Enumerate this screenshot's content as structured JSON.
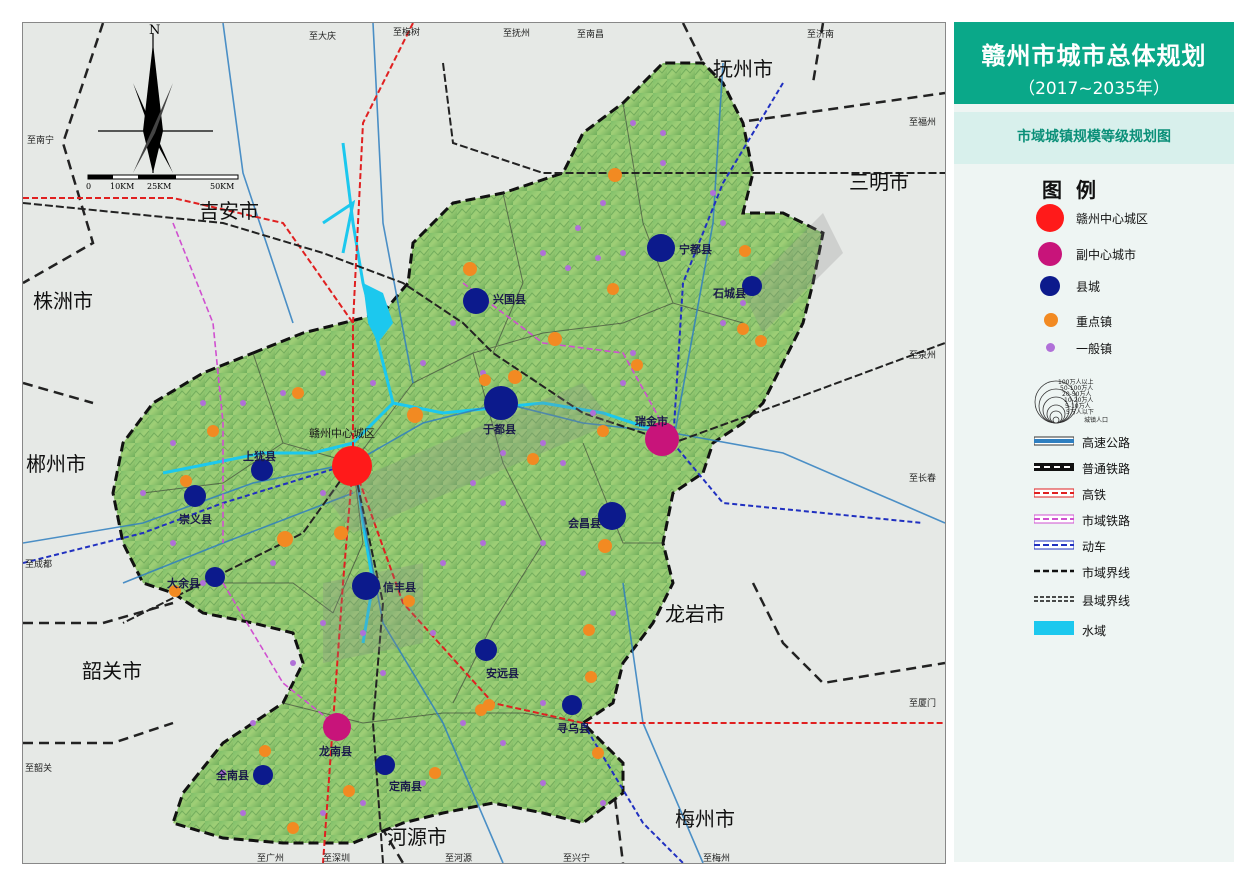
{
  "panel": {
    "title": "赣州市城市总体规划",
    "years": "（2017~2035年）",
    "subtitle": "市域城镇规模等级规划图",
    "legend_heading": "图例",
    "legend": {
      "center": "赣州中心城区",
      "sub_center": "副中心城市",
      "county": "县城",
      "key_town": "重点镇",
      "general_town": "一般镇",
      "pop_caption": "城镇人口",
      "pop_levels": [
        "100万人以上",
        "50-100万人",
        "20-50万人",
        "10-20万人",
        "5-10万人",
        "5万人以下"
      ],
      "expressway": "高速公路",
      "railway": "普通铁路",
      "hsr": "高铁",
      "metro_rail": "市域铁路",
      "emu": "动车",
      "city_boundary": "市域界线",
      "county_boundary": "县域界线",
      "water": "水域"
    },
    "colors": {
      "header": "#0aa889",
      "center": "#ff1a1a",
      "sub_center": "#c8147a",
      "county": "#0c1a8c",
      "key_town": "#f28a22",
      "general_town": "#b070d8",
      "expressway": "#2f7fc0",
      "hsr": "#e02020",
      "metro_rail": "#d050d0",
      "emu": "#2030c0",
      "water": "#1cc8ee"
    }
  },
  "map": {
    "compass": "N",
    "scale": [
      "0",
      "10KM",
      "25KM",
      "50KM"
    ],
    "regions": {
      "fuzhou": "抚州市",
      "sanming": "三明市",
      "jian": "吉安市",
      "zhuzhou": "株洲市",
      "chenzhou": "郴州市",
      "shaoguan": "韶关市",
      "longyan": "龙岩市",
      "heyuan": "河源市",
      "meizhou": "梅州市"
    },
    "center_city": "赣州中心城区",
    "counties": {
      "ningdu": "宁都县",
      "xingguo": "兴国县",
      "shicheng": "石城县",
      "yudu": "于都县",
      "ruijin": "瑞金市",
      "shangyou": "上犹县",
      "chongyi": "崇义县",
      "huichang": "会昌县",
      "dayu": "大余县",
      "xinfeng": "信丰县",
      "anyuan": "安远县",
      "xunwu": "寻乌县",
      "longnan": "龙南县",
      "quannan": "全南县",
      "dingnan": "定南县"
    },
    "edge_labels": {
      "to_daqing": "至大庆",
      "to_meizhou_top": "至梅树",
      "to_fuzhou": "至抚州",
      "to_nanchang": "至南昌",
      "to_jinan": "至济南",
      "to_fuzhou2": "至福州",
      "to_nanning": "至南宁",
      "to_quanzhou": "至泉州",
      "to_changchun": "至长春",
      "to_xiamen": "至厦门",
      "to_chengdu": "至成都",
      "to_shaoguan": "至韶关",
      "to_guangzhou": "至广州",
      "to_shenzhen": "至深圳",
      "to_heyuan": "至河源",
      "to_xingning": "至兴宁",
      "to_meizhou": "至梅州"
    }
  }
}
